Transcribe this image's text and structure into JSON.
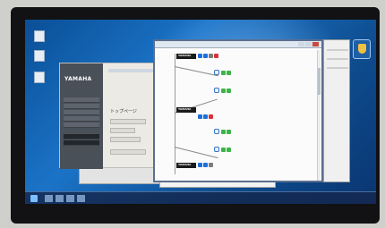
{
  "desktop": {
    "icons": [
      {
        "name": "computer-icon"
      },
      {
        "name": "document-icon"
      },
      {
        "name": "document-icon"
      }
    ],
    "taskbar": {
      "clock": ""
    }
  },
  "browser": {
    "logo_text": "YAMAHA",
    "page_title": "トップページ",
    "nav": [
      {
        "label": ""
      },
      {
        "label": ""
      },
      {
        "label": ""
      },
      {
        "label": ""
      },
      {
        "label": ""
      },
      {
        "label": ""
      },
      {
        "label": ""
      }
    ]
  },
  "editor": {
    "device_logo": "YAMAHA"
  },
  "colors": {
    "desktop": "#1b73c7",
    "port_blue": "#1e6fd9",
    "port_green": "#3cb44a",
    "port_red": "#d8333a"
  }
}
